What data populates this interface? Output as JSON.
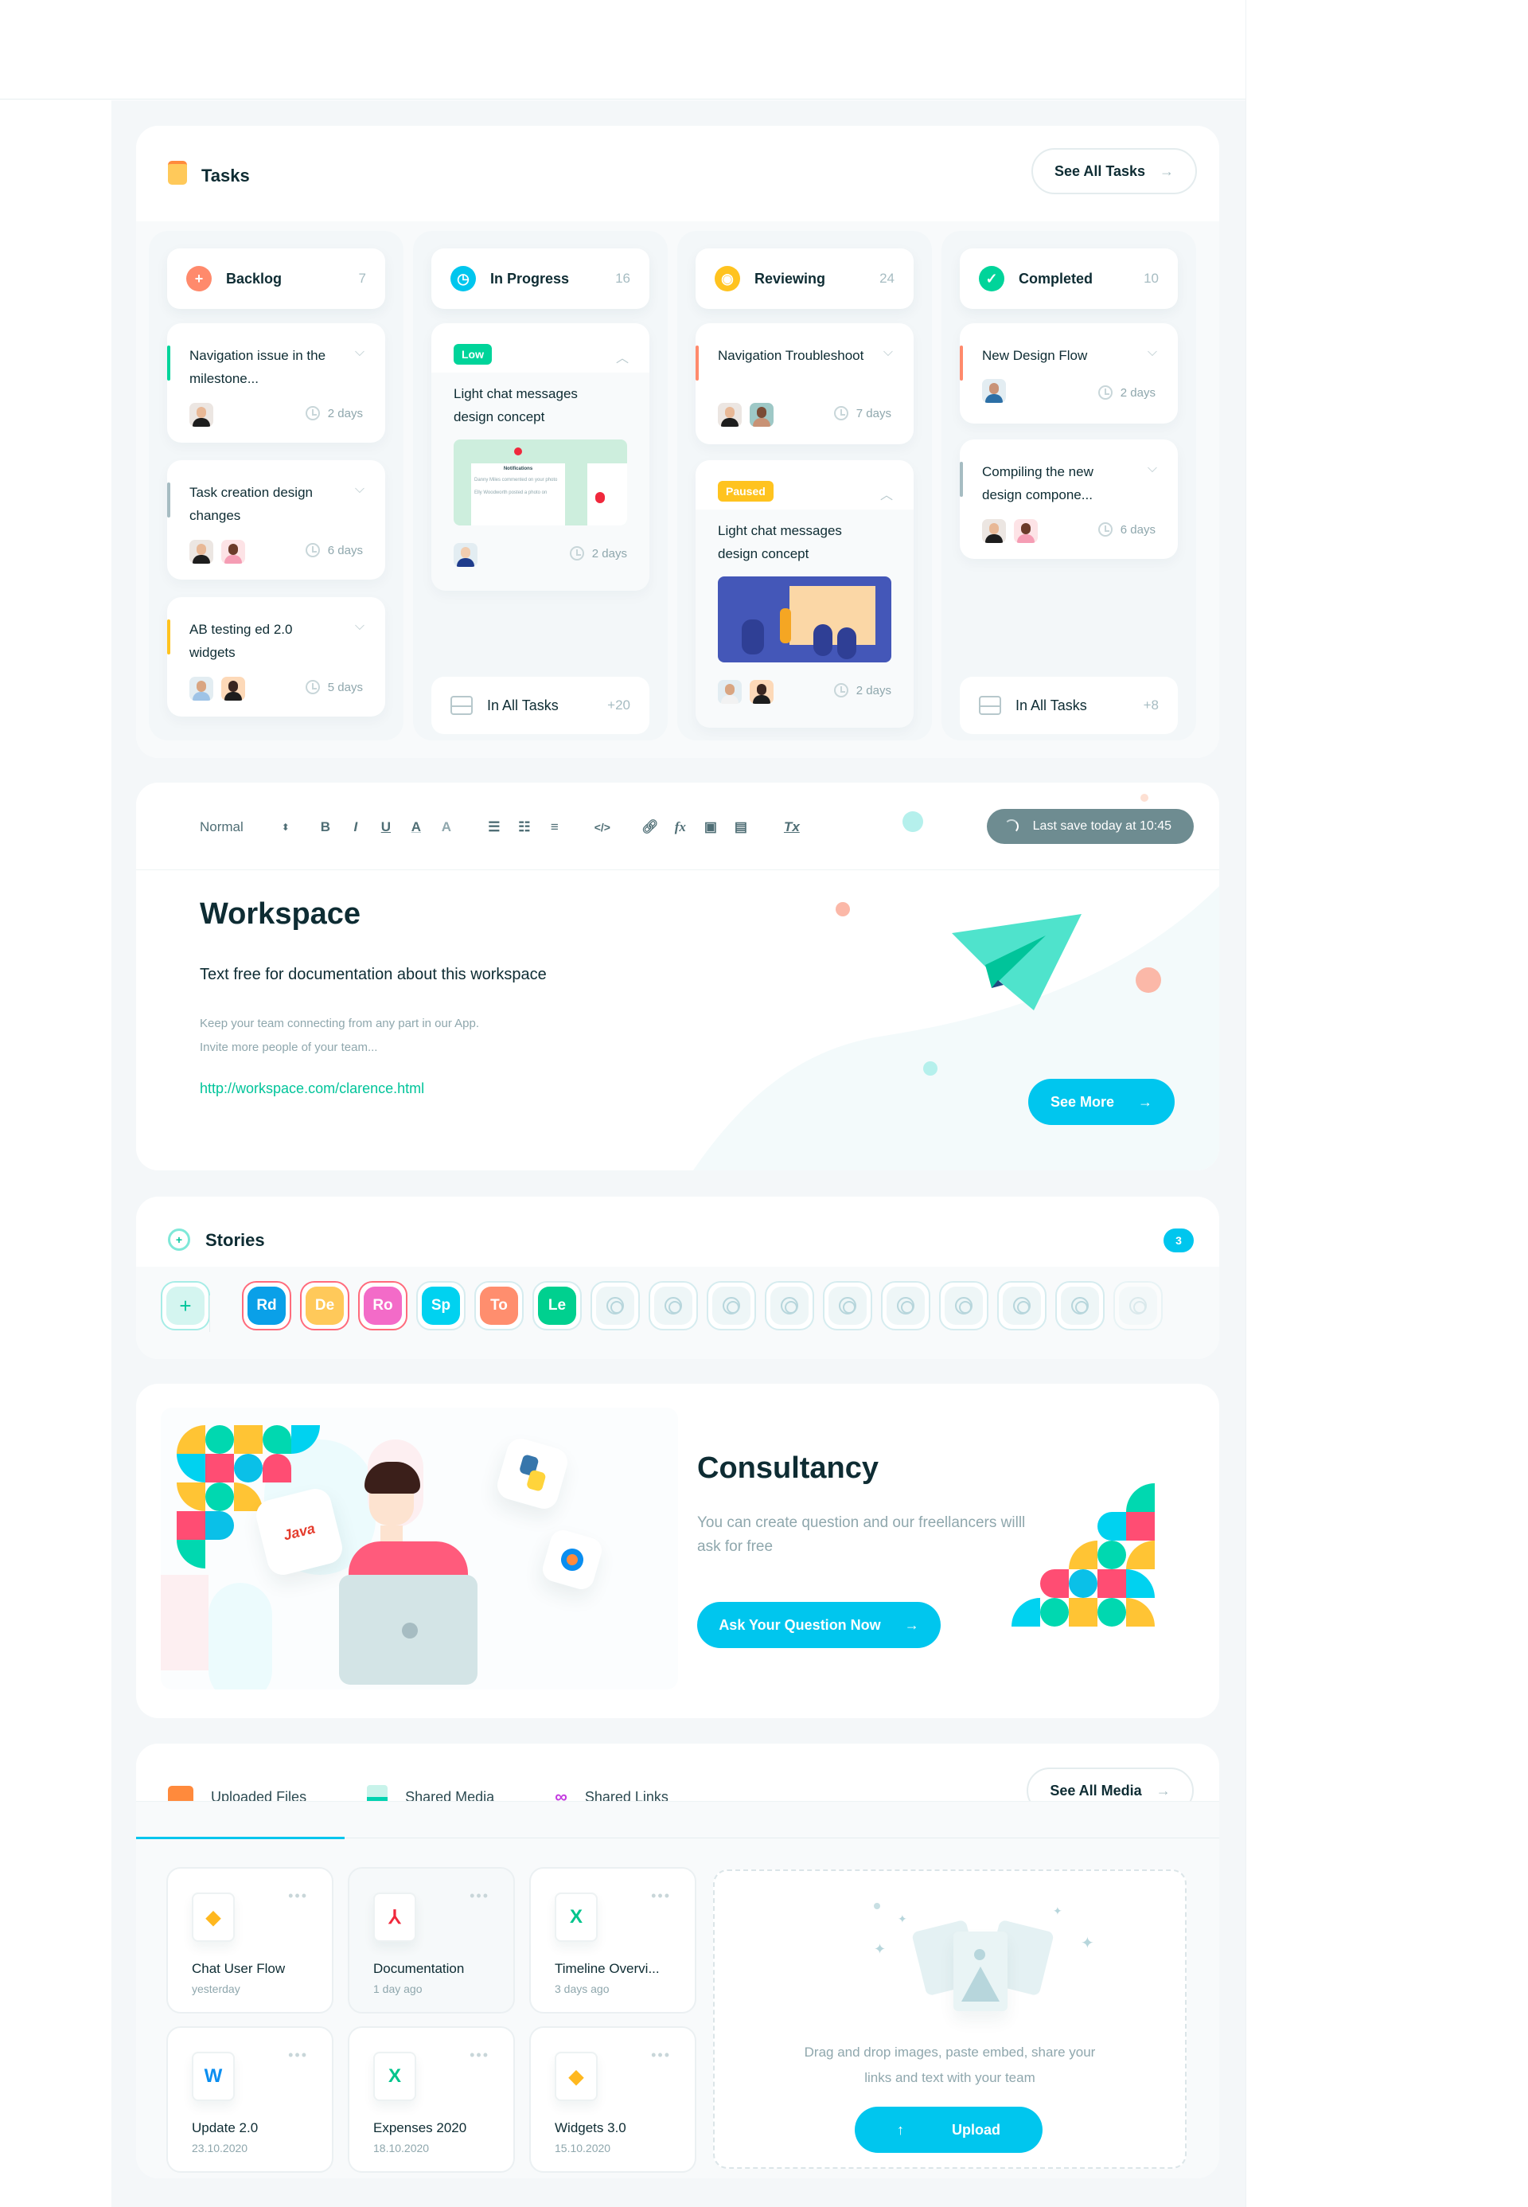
{
  "tasks": {
    "title": "Tasks",
    "see_all_label": "See All Tasks",
    "columns": [
      {
        "name": "Backlog",
        "count": "7",
        "color": "#ff8a6c",
        "icon": "plus-icon",
        "cards": [
          {
            "title": "Navigation issue in the milestone...",
            "due": "2 days",
            "accent": "#00d49a",
            "avatars": 1
          },
          {
            "title": "Task creation design changes",
            "due": "6 days",
            "accent": "#a6bcc2",
            "avatars": 2
          },
          {
            "title": "AB testing ed 2.0 widgets",
            "due": "5 days",
            "accent": "#ffc31f",
            "avatars": 2
          }
        ]
      },
      {
        "name": "In Progress",
        "count": "16",
        "color": "#00c6ee",
        "icon": "clock-icon",
        "cards": [
          {
            "tag": "Low",
            "tag_color": "#00d49a",
            "title": "Light chat messages design concept",
            "due": "2 days",
            "avatars": 1,
            "preview": {
              "header": "Notifications",
              "row1": "Danny Miles commented on your photo",
              "row2": "Elly Woodworth posted a photo on"
            }
          }
        ],
        "footer": {
          "label": "In All Tasks",
          "count": "+20"
        }
      },
      {
        "name": "Reviewing",
        "count": "24",
        "color": "#ffc31f",
        "icon": "eye-icon",
        "cards": [
          {
            "title": "Navigation Troubleshoot",
            "due": "7 days",
            "accent": "#ff8a6c",
            "avatars": 2
          },
          {
            "tag": "Paused",
            "tag_color": "#ffc31f",
            "title": "Light chat messages design concept",
            "due": "2 days",
            "avatars": 2
          }
        ]
      },
      {
        "name": "Completed",
        "count": "10",
        "color": "#00d49a",
        "icon": "check-icon",
        "cards": [
          {
            "title": "New Design Flow",
            "due": "2 days",
            "accent": "#ff8a6c",
            "avatars": 1
          },
          {
            "title": "Compiling the new design compone...",
            "due": "6 days",
            "accent": "#a6bcc2",
            "avatars": 2
          }
        ],
        "footer": {
          "label": "In All Tasks",
          "count": "+8"
        }
      }
    ]
  },
  "editor": {
    "style_select": "Normal",
    "save_status": "Last save today at 10:45",
    "heading": "Workspace",
    "subheading": "Text free for documentation about this workspace",
    "paragraph_1": "Keep your team connecting from any part in our App.",
    "paragraph_2": "Invite more people of your team...",
    "link": "http://workspace.com/clarence.html",
    "see_more_label": "See More"
  },
  "stories": {
    "title": "Stories",
    "badge": "3",
    "items": [
      {
        "initials": "Rd",
        "color": "#0aa0e8",
        "unseen": true
      },
      {
        "initials": "De",
        "color": "#ffc95a",
        "unseen": true
      },
      {
        "initials": "Ro",
        "color": "#f36bc8",
        "unseen": true
      },
      {
        "initials": "Sp",
        "color": "#00d2f0",
        "unseen": false
      },
      {
        "initials": "To",
        "color": "#ff8e6e",
        "unseen": false
      },
      {
        "initials": "Le",
        "color": "#00d08f",
        "unseen": false
      }
    ],
    "empty_slots": 10
  },
  "consultancy": {
    "title": "Consultancy",
    "text": "You can create question and our freellancers willl ask for free",
    "button_label": "Ask Your Question Now",
    "badges": [
      "Java",
      "Python",
      "Settings"
    ]
  },
  "media": {
    "tabs": [
      {
        "label": "Uploaded Files",
        "icon": "folder-icon",
        "active": true
      },
      {
        "label": "Shared Media",
        "icon": "image-icon",
        "active": false
      },
      {
        "label": "Shared Links",
        "icon": "link-icon",
        "active": false
      }
    ],
    "see_all_label": "See All Media",
    "files": [
      {
        "name": "Chat User Flow",
        "date": "yesterday",
        "type": "sketch",
        "glyph": "◆",
        "color": "#ffb81f"
      },
      {
        "name": "Documentation",
        "date": "1 day ago",
        "type": "pdf",
        "glyph": "⅄",
        "color": "#f0283c"
      },
      {
        "name": "Timeline Overvi...",
        "date": "3 days ago",
        "type": "excel",
        "glyph": "X",
        "color": "#00c48c"
      },
      {
        "name": "Update 2.0",
        "date": "23.10.2020",
        "type": "word",
        "glyph": "W",
        "color": "#0a8ef0"
      },
      {
        "name": "Expenses 2020",
        "date": "18.10.2020",
        "type": "excel",
        "glyph": "X",
        "color": "#00c48c"
      },
      {
        "name": "Widgets 3.0",
        "date": "15.10.2020",
        "type": "sketch",
        "glyph": "◆",
        "color": "#ffb81f"
      }
    ],
    "dropzone_text_1": "Drag and drop images, paste embed, share your",
    "dropzone_text_2": "links and text with your team",
    "upload_label": "Upload"
  }
}
